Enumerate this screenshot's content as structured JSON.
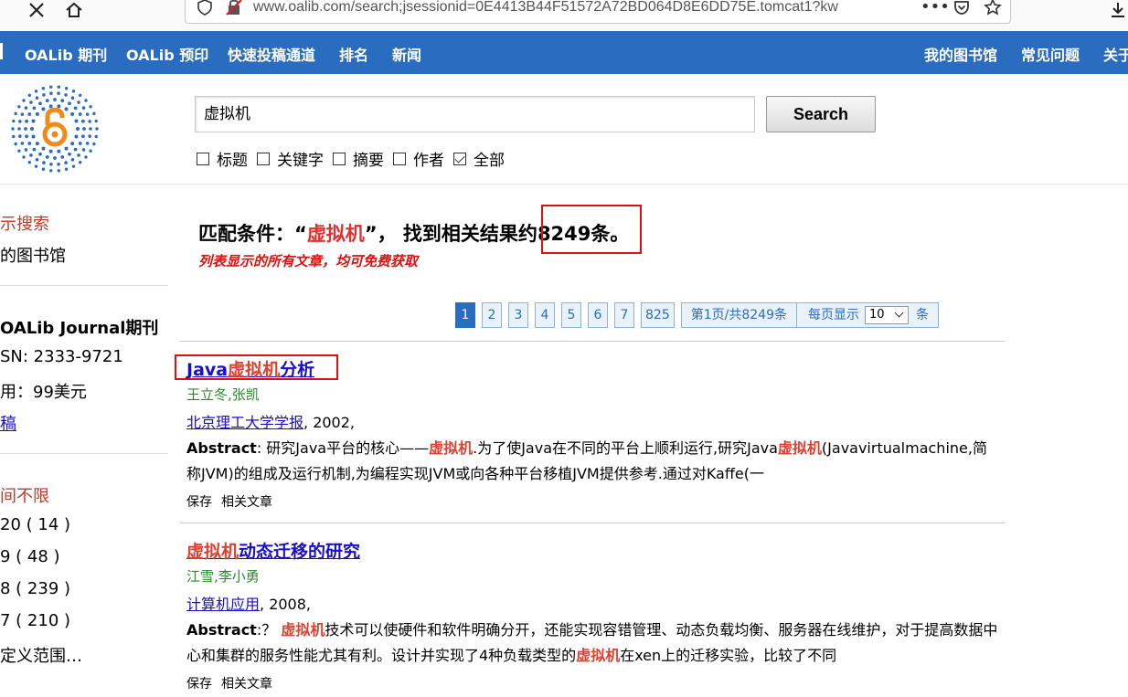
{
  "browser": {
    "url": "www.oalib.com/search;jsessionid=0E4413B44F51572A72BD064D8E6DD75E.tomcat1?kw",
    "url_more": "•••"
  },
  "nav": {
    "left_items": [
      "OALib 期刊",
      "OALib 预印",
      "快速投稿通道",
      "排名",
      "新闻"
    ],
    "right_items": [
      "我的图书馆",
      "常见问题",
      "关于"
    ]
  },
  "search": {
    "value": "虚拟机",
    "button": "Search",
    "options": [
      {
        "label": "标题",
        "checked": false
      },
      {
        "label": "关键字",
        "checked": false
      },
      {
        "label": "摘要",
        "checked": false
      },
      {
        "label": "作者",
        "checked": false
      },
      {
        "label": "全部",
        "checked": true
      }
    ]
  },
  "sidebar": {
    "advanced_search": "示搜索",
    "my_library": "的图书馆",
    "journal_title": "OALib Journal期刊",
    "issn": "SN: 2333-9721",
    "fee": "用：99美元",
    "submit": "稿",
    "time_unlimited": "间不限",
    "years": [
      "20 ( 14 )",
      "9 ( 48 )",
      "8 ( 239 )",
      "7 ( 210 )"
    ],
    "custom_range": "定义范围…"
  },
  "summary": {
    "prefix": "匹配条件：“",
    "keyword": "虚拟机",
    "middle": "”， 找到相关结果约",
    "count": "8249条。",
    "free_note": "列表显示的所有文章，均可免费获取"
  },
  "pager": {
    "pages": [
      "1",
      "2",
      "3",
      "4",
      "5",
      "6",
      "7",
      "825"
    ],
    "info": "第1页/共8249条",
    "per_page_label": "每页显示",
    "per_page_value": "10",
    "per_page_unit": "条"
  },
  "results": [
    {
      "title_pre": "Java",
      "title_kw": "虚拟机",
      "title_post": "分析",
      "authors": "王立冬,张凯",
      "journal": "北京理工大学学报",
      "year": ", 2002,",
      "abs_label": "Abstract",
      "abs_a": ":  研究Java平台的核心——",
      "abs_kw1": "虚拟机",
      "abs_b": ".为了使Java在不同的平台上顺利运行,研究Java",
      "abs_kw2": "虚拟机",
      "abs_c": "(Javavirtualmachine,简称JVM)的组成及运行机制,为编程实现JVM或向各种平台移植JVM提供参考.通过对Kaffe(一",
      "save": "保存",
      "related": "相关文章"
    },
    {
      "title_pre": "",
      "title_kw": "虚拟机",
      "title_post": "动态迁移的研究",
      "authors": "江雪,李小勇",
      "journal": "计算机应用",
      "year": ", 2008,",
      "abs_label": "Abstract",
      "abs_a": ":？ ",
      "abs_kw1": "虚拟机",
      "abs_b": "技术可以使硬件和软件明确分开，还能实现容错管理、动态负载均衡、服务器在线维护，对于提高数据中心和集群的服务性能尤其有利。设计并实现了4种负载类型的",
      "abs_kw2": "虚拟机",
      "abs_c": "在xen上的迁移实验，比较了不同",
      "save": "保存",
      "related": "相关文章"
    }
  ],
  "colors": {
    "nav_bg": "#2a6cbf",
    "keyword_red": "#e04030",
    "highlight_box": "#e01010",
    "link_blue": "#1a0dcc",
    "author_green": "#2a8a2a"
  }
}
